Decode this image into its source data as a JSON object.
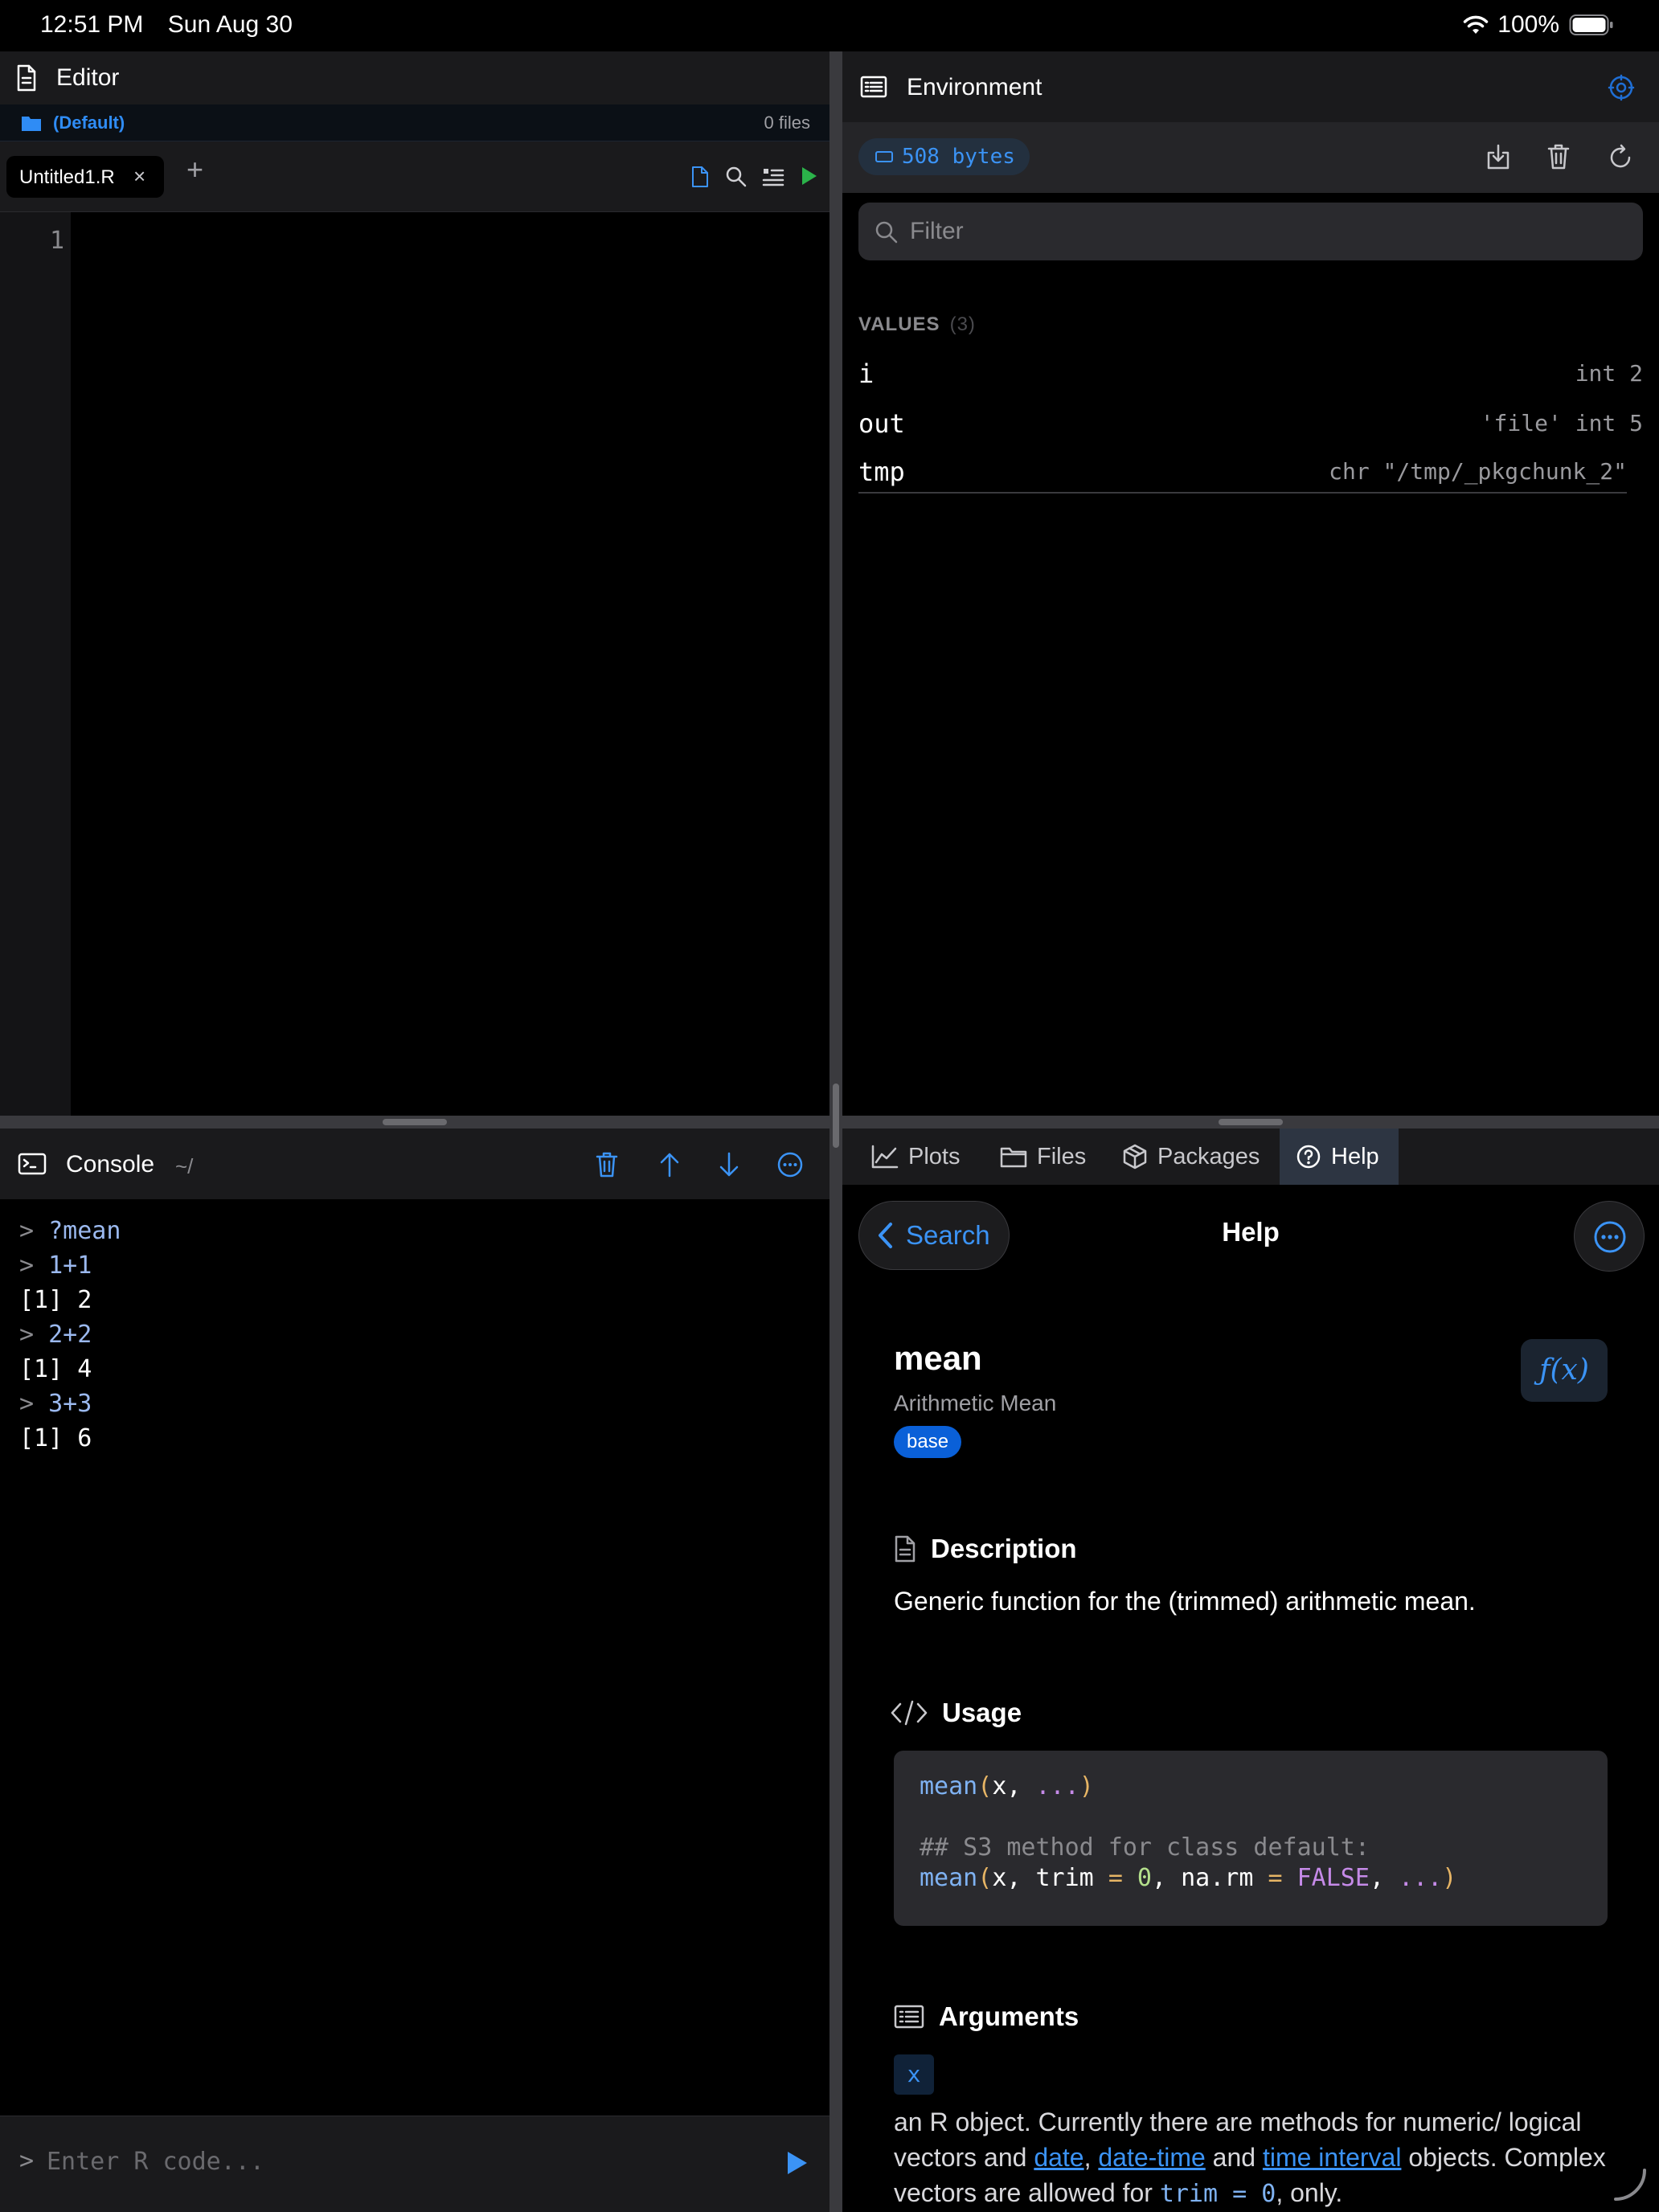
{
  "status_bar": {
    "time": "12:51 PM",
    "date": "Sun Aug 30",
    "battery": "100%"
  },
  "editor": {
    "title": "Editor",
    "project": "(Default)",
    "file_count": "0 files",
    "tabs": [
      {
        "label": "Untitled1.R"
      }
    ],
    "line_numbers": [
      "1"
    ]
  },
  "console": {
    "title": "Console",
    "path": "~/",
    "lines": [
      {
        "kind": "cmd",
        "prompt": ">",
        "text": "?mean"
      },
      {
        "kind": "cmd",
        "prompt": ">",
        "text": "1+1"
      },
      {
        "kind": "out",
        "prompt": "",
        "text": "[1] 2"
      },
      {
        "kind": "cmd",
        "prompt": ">",
        "text": "2+2"
      },
      {
        "kind": "out",
        "prompt": "",
        "text": "[1] 4"
      },
      {
        "kind": "cmd",
        "prompt": ">",
        "text": "3+3"
      },
      {
        "kind": "out",
        "prompt": "",
        "text": "[1] 6"
      }
    ],
    "input_prompt": ">",
    "input_placeholder": "Enter R code..."
  },
  "environment": {
    "title": "Environment",
    "memory": "508 bytes",
    "filter_placeholder": "Filter",
    "values_header": "VALUES",
    "values_count": "(3)",
    "values": [
      {
        "name": "i",
        "value": "int 2"
      },
      {
        "name": "out",
        "value": "'file' int 5"
      },
      {
        "name": "tmp",
        "value": "chr \"/tmp/_pkgchunk_2\""
      }
    ]
  },
  "panel_tabs": [
    {
      "label": "Plots",
      "icon": "chart-line-icon"
    },
    {
      "label": "Files",
      "icon": "folder-icon"
    },
    {
      "label": "Packages",
      "icon": "package-icon"
    },
    {
      "label": "Help",
      "icon": "question-circle-icon",
      "active": true
    }
  ],
  "help": {
    "back_label": "Search",
    "title": "Help",
    "function_name": "mean",
    "function_title": "Arithmetic Mean",
    "package": "base",
    "fx_label": "ƒ(x)",
    "description_heading": "Description",
    "description": "Generic function for the (trimmed) arithmetic mean.",
    "usage_heading": "Usage",
    "usage_line1": {
      "fn": "mean",
      "open": "(",
      "arg": "x, ",
      "dots": "...",
      "close": ")"
    },
    "usage_comment": "## S3 method for class default:",
    "usage_line2": {
      "fn": "mean",
      "open": "(",
      "a1": "x, trim ",
      "eq1": "=",
      "v1": " 0",
      "a2": ", na.rm ",
      "eq2": "=",
      "v2": " FALSE",
      "a3": ", ",
      "dots": "...",
      "close": ")"
    },
    "arguments_heading": "Arguments",
    "arg_name": "x",
    "arg_desc_1": "an R object. Currently there are methods for numeric/ logical vectors and ",
    "arg_link_1": "date",
    "arg_sep_1": ", ",
    "arg_link_2": "date-time",
    "arg_sep_2": " and ",
    "arg_link_3": "time interval",
    "arg_desc_2": " objects. Complex vectors are allowed for ",
    "arg_code": "trim = 0",
    "arg_desc_3": ", only."
  },
  "colors": {
    "accent": "#3b93f5",
    "background": "#000000",
    "panel": "#1a1a1c",
    "badge": "#0a60d8"
  }
}
